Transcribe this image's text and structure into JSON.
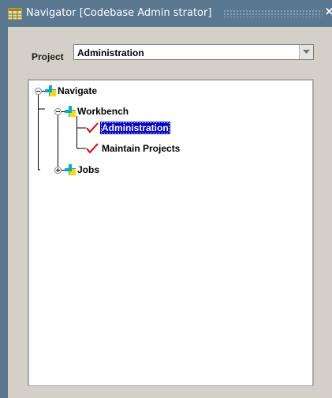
{
  "window": {
    "title": "Navigator [Codebase Admin strator]",
    "titlebar_color": "#5a7890",
    "panel_color": "#d4d0c8"
  },
  "project": {
    "label": "Project",
    "selected": "Administration"
  },
  "tree": {
    "root": {
      "label": "Navigate",
      "expanded": true,
      "icon": "cross-icon"
    },
    "workbench": {
      "label": "Workbench",
      "expanded": true,
      "icon": "cross-icon"
    },
    "items": [
      {
        "label": "Administration",
        "selected": true,
        "icon": "checkmark-icon"
      },
      {
        "label": "Maintain Projects",
        "selected": false,
        "icon": "checkmark-icon"
      }
    ],
    "jobs": {
      "label": "Jobs",
      "expanded": false,
      "icon": "cross-icon"
    },
    "selection_color": "#0000cc",
    "cross_icon_colors": [
      "#00b0c0",
      "#ffd800"
    ],
    "checkmark_color": "#e00000"
  }
}
